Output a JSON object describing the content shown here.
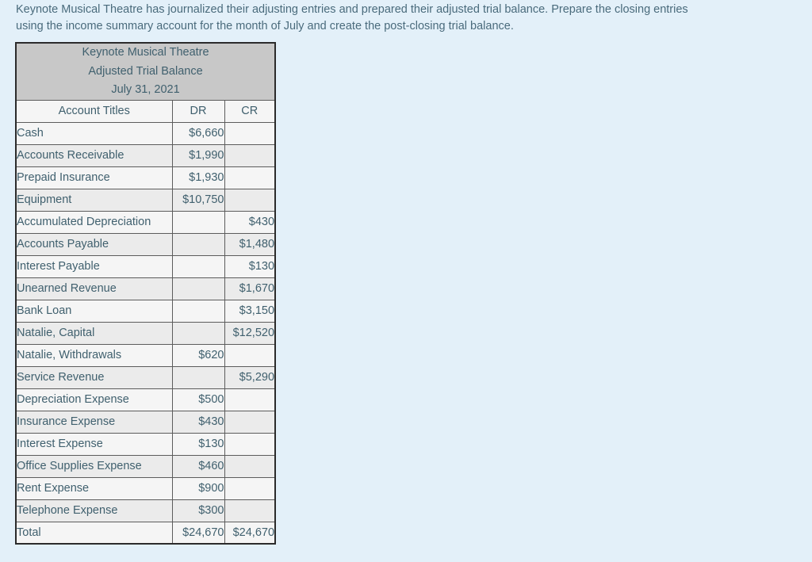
{
  "question": {
    "line1": "Keynote Musical Theatre has journalized their adjusting entries and prepared their adjusted trial balance. Prepare the closing entries",
    "line2": "using the income summary account for the month of July and create the post-closing trial balance."
  },
  "table": {
    "company_name": "Keynote Musical Theatre",
    "statement_name": "Adjusted Trial Balance",
    "statement_date": "July 31, 2021",
    "columns": [
      "Account Titles",
      "DR",
      "CR"
    ],
    "rows": [
      {
        "title": "Cash",
        "dr": "$6,660",
        "cr": ""
      },
      {
        "title": "Accounts Receivable",
        "dr": "$1,990",
        "cr": ""
      },
      {
        "title": "Prepaid Insurance",
        "dr": "$1,930",
        "cr": ""
      },
      {
        "title": "Equipment",
        "dr": "$10,750",
        "cr": ""
      },
      {
        "title": "Accumulated Depreciation",
        "dr": "",
        "cr": "$430"
      },
      {
        "title": "Accounts Payable",
        "dr": "",
        "cr": "$1,480"
      },
      {
        "title": "Interest Payable",
        "dr": "",
        "cr": "$130"
      },
      {
        "title": "Unearned Revenue",
        "dr": "",
        "cr": "$1,670"
      },
      {
        "title": "Bank Loan",
        "dr": "",
        "cr": "$3,150"
      },
      {
        "title": "Natalie, Capital",
        "dr": "",
        "cr": "$12,520"
      },
      {
        "title": "Natalie, Withdrawals",
        "dr": "$620",
        "cr": ""
      },
      {
        "title": "Service Revenue",
        "dr": "",
        "cr": "$5,290"
      },
      {
        "title": "Depreciation Expense",
        "dr": "$500",
        "cr": ""
      },
      {
        "title": "Insurance Expense",
        "dr": "$430",
        "cr": ""
      },
      {
        "title": "Interest Expense",
        "dr": "$130",
        "cr": ""
      },
      {
        "title": "Office Supplies Expense",
        "dr": "$460",
        "cr": ""
      },
      {
        "title": "Rent Expense",
        "dr": "$900",
        "cr": ""
      },
      {
        "title": "Telephone Expense",
        "dr": "$300",
        "cr": ""
      },
      {
        "title": "Total",
        "dr": "$24,670",
        "cr": "$24,670"
      }
    ]
  },
  "colors": {
    "page_background": "#e3f0f9",
    "text": "#40606e",
    "title_block_background": "#c8c8c8",
    "row_odd_background": "#f5f5f5",
    "row_even_background": "#ebebeb",
    "border": "#2b2b2b"
  }
}
